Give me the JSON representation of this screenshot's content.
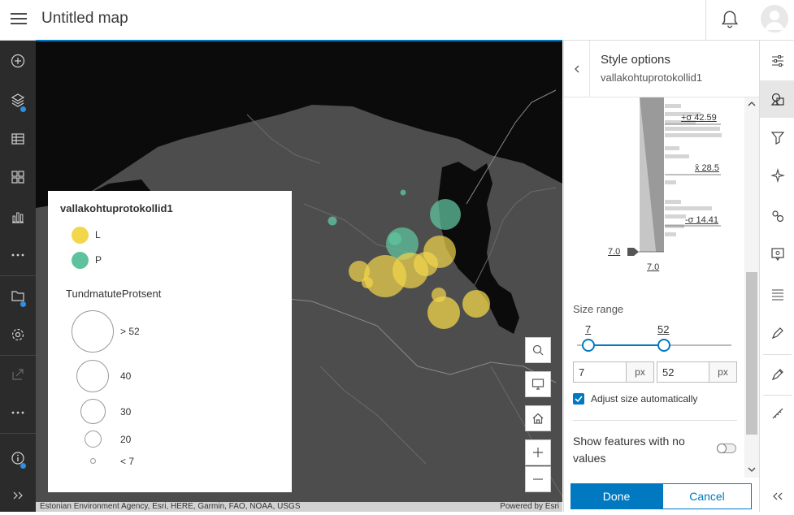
{
  "header": {
    "title": "Untitled map"
  },
  "left_toolbar": {
    "items": [
      "add-icon",
      "layers-icon",
      "table-icon",
      "basemap-icon",
      "charts-icon",
      "more-icon",
      "save-icon",
      "settings-icon",
      "share-icon",
      "more-icon",
      "info-icon",
      "expand-icon"
    ]
  },
  "legend": {
    "layer_title": "vallakohtuprotokollid1",
    "categories": [
      {
        "label": "L",
        "color": "#f2d64b"
      },
      {
        "label": "P",
        "color": "#5fc29e"
      }
    ],
    "size_field": "TundmatuteProtsent",
    "size_labels": [
      "> 52",
      "40",
      "30",
      "20",
      "< 7"
    ]
  },
  "attribution": {
    "left": "Estonian Environment Agency, Esri, HERE, Garmin, FAO, NOAA, USGS",
    "right": "Powered by Esri"
  },
  "panel": {
    "title": "Style options",
    "subtitle": "vallakohtuprotokollid1",
    "histogram": {
      "plus_sigma": "+σ 42.59",
      "mean": "x̄ 28.5",
      "minus_sigma": "-σ 14.41",
      "handle_value": "7.0",
      "min_value": "7.0"
    },
    "size_range": {
      "label": "Size range",
      "min_label": "7",
      "max_label": "52",
      "min_value": "7",
      "max_value": "52",
      "unit": "px",
      "min_fraction": 0.0,
      "max_fraction": 0.49
    },
    "adjust_label": "Adjust size automatically",
    "adjust_checked": true,
    "show_no_values_label": "Show features with no values",
    "show_no_values_on": false,
    "done_label": "Done",
    "cancel_label": "Cancel"
  },
  "right_toolbar": {
    "items": [
      "properties-icon",
      "styles-icon",
      "filter-icon",
      "effects-icon",
      "pop-ups-icon",
      "configure-popups-icon",
      "labels-icon",
      "fields-icon",
      "sketch-icon",
      "measure-icon",
      "collapse-icon"
    ]
  },
  "colors": {
    "accent": "#0079c1",
    "category_L": "#f2d64b",
    "category_P": "#5fc29e"
  }
}
